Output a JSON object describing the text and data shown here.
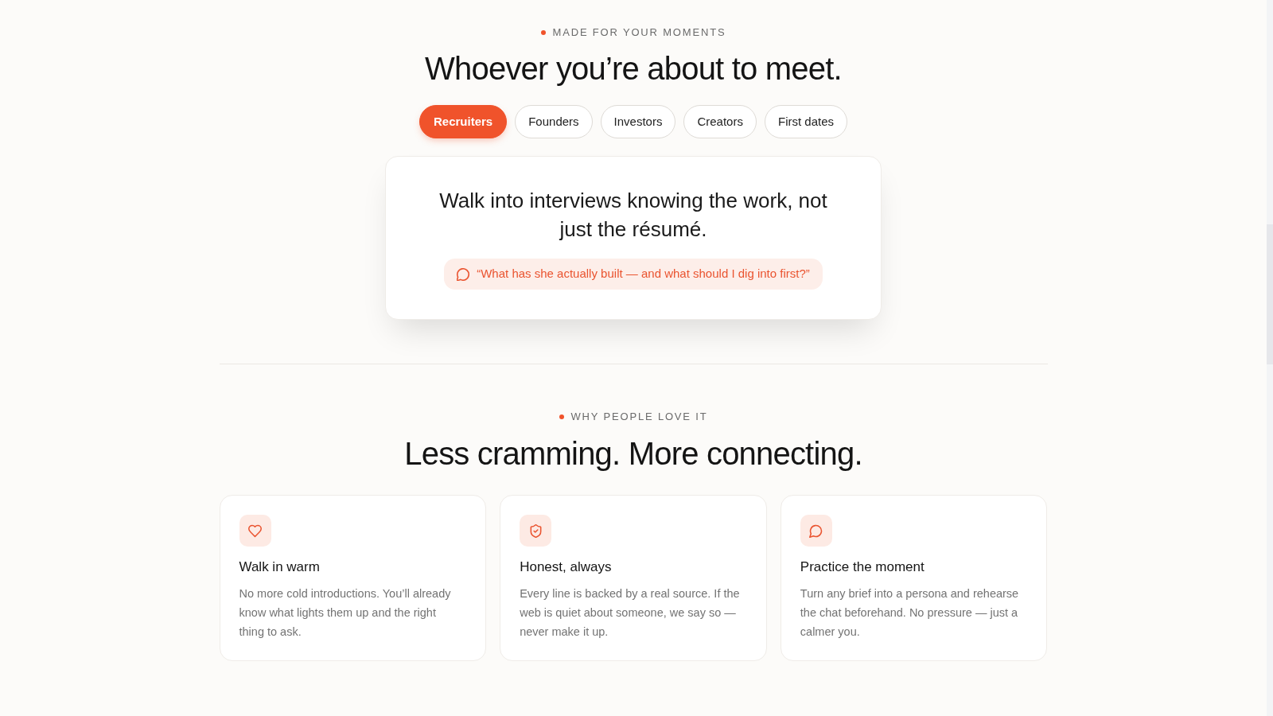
{
  "moments": {
    "eyebrow": "MADE FOR YOUR MOMENTS",
    "heading": "Whoever you’re about to meet.",
    "tabs": [
      {
        "label": "Recruiters",
        "selected": true
      },
      {
        "label": "Founders",
        "selected": false
      },
      {
        "label": "Investors",
        "selected": false
      },
      {
        "label": "Creators",
        "selected": false
      },
      {
        "label": "First dates",
        "selected": false
      }
    ],
    "panel": {
      "headline": "Walk into interviews knowing the work, not just the résumé.",
      "quote": "“What has she actually built — and what should I dig into first?”"
    }
  },
  "why": {
    "eyebrow": "WHY PEOPLE LOVE IT",
    "heading": "Less cramming. More connecting.",
    "features": [
      {
        "title": "Walk in warm",
        "body": "No more cold introductions. You’ll already know what lights them up and the right thing to ask."
      },
      {
        "title": "Honest, always",
        "body": "Every line is backed by a real source. If the web is quiet about someone, we say so — never make it up."
      },
      {
        "title": "Practice the moment",
        "body": "Turn any brief into a persona and rehearse the chat beforehand. No pressure — just a calmer you."
      }
    ]
  }
}
